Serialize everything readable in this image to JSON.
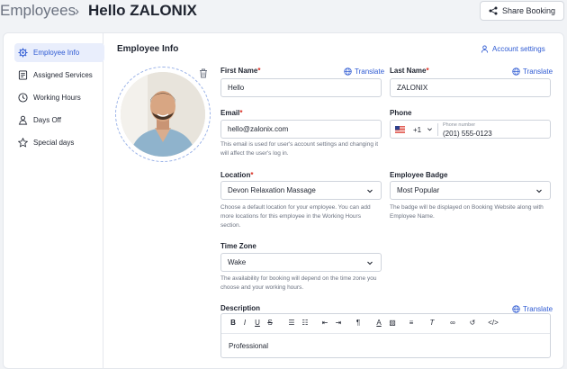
{
  "header": {
    "breadcrumb_root": "Employees",
    "breadcrumb_sep": "›",
    "title": "Hello ZALONIX",
    "share_label": "Share Booking"
  },
  "sidebar": {
    "items": [
      {
        "label": "Employee Info",
        "icon": "gear-icon",
        "active": true
      },
      {
        "label": "Assigned Services",
        "icon": "list-icon",
        "active": false
      },
      {
        "label": "Working Hours",
        "icon": "clock-icon",
        "active": false
      },
      {
        "label": "Days Off",
        "icon": "person-icon",
        "active": false
      },
      {
        "label": "Special days",
        "icon": "star-icon",
        "active": false
      }
    ]
  },
  "section": {
    "title": "Employee Info",
    "account_settings": "Account settings"
  },
  "form": {
    "first_name": {
      "label": "First Name",
      "required": "*",
      "value": "Hello",
      "translate": "Translate"
    },
    "last_name": {
      "label": "Last Name",
      "required": "*",
      "value": "ZALONIX",
      "translate": "Translate"
    },
    "email": {
      "label": "Email",
      "required": "*",
      "value": "hello@zalonix.com",
      "help": "This email is used for user's account settings and changing it will affect the user's log in."
    },
    "phone": {
      "label": "Phone",
      "code": "+1",
      "placeholder": "Phone number",
      "value": "(201) 555-0123"
    },
    "location": {
      "label": "Location",
      "required": "*",
      "value": "Devon Relaxation Massage",
      "help": "Choose a default location for your employee. You can add more locations for this employee in the Working Hours section."
    },
    "badge": {
      "label": "Employee Badge",
      "value": "Most Popular",
      "help": "The badge will be displayed on Booking Website along with Employee Name."
    },
    "timezone": {
      "label": "Time Zone",
      "value": "Wake",
      "help": "The availability for booking will depend on the time zone you choose and your working hours."
    },
    "description": {
      "label": "Description",
      "translate": "Translate",
      "value": "Professional"
    }
  },
  "colors": {
    "accent": "#2f5bd3",
    "required": "#d92d20"
  }
}
